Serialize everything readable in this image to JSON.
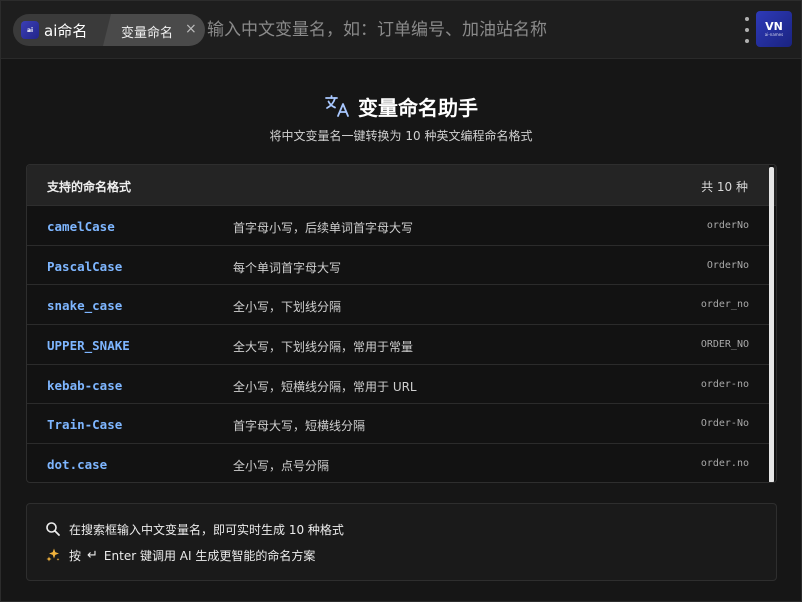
{
  "app": {
    "name": "ai命名",
    "badge_text": "ai",
    "tag_label": "变量命名",
    "tag_close": "×"
  },
  "search": {
    "placeholder": "输入中文变量名，如：订单编号、加油站名称"
  },
  "avatar": {
    "line1": "VN",
    "line2": "ai-names"
  },
  "hero": {
    "title": "变量命名助手",
    "subtitle": "将中文变量名一键转换为 10 种英文编程命名格式"
  },
  "formats": {
    "header": "支持的命名格式",
    "count": "共 10 种",
    "items": [
      {
        "name": "camelCase",
        "desc": "首字母小写，后续单词首字母大写",
        "example": "orderNo"
      },
      {
        "name": "PascalCase",
        "desc": "每个单词首字母大写",
        "example": "OrderNo"
      },
      {
        "name": "snake_case",
        "desc": "全小写，下划线分隔",
        "example": "order_no"
      },
      {
        "name": "UPPER_SNAKE",
        "desc": "全大写，下划线分隔，常用于常量",
        "example": "ORDER_NO"
      },
      {
        "name": "kebab-case",
        "desc": "全小写，短横线分隔，常用于 URL",
        "example": "order-no"
      },
      {
        "name": "Train-Case",
        "desc": "首字母大写，短横线分隔",
        "example": "Order-No"
      },
      {
        "name": "dot.case",
        "desc": "全小写，点号分隔",
        "example": "order.no"
      }
    ]
  },
  "tips": {
    "tip1": "在搜索框输入中文变量名，即可实时生成 10 种格式",
    "tip2_prefix": "按",
    "tip2_enter": "↵",
    "tip2_rest": "Enter 键调用 AI 生成更智能的命名方案"
  },
  "colors": {
    "accent_blue": "#7eb6ff",
    "sparkle_gold": "#f2b33d",
    "badge_blue": "#2e3ab8"
  }
}
